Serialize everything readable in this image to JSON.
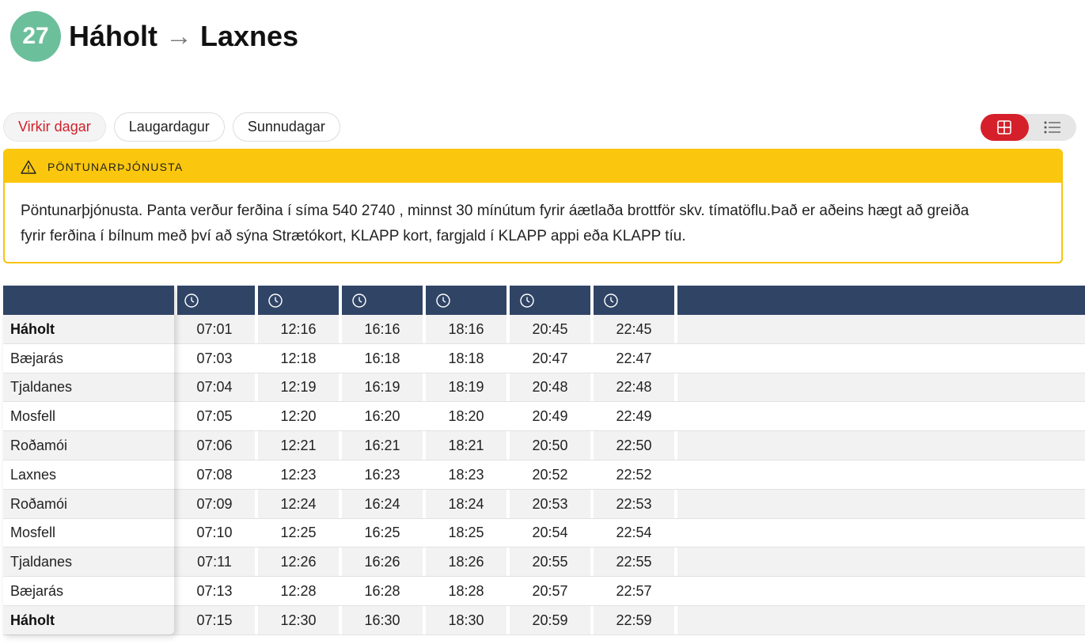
{
  "route": {
    "number": "27",
    "from": "Háholt",
    "arrow": "→",
    "to": "Laxnes",
    "badge_color": "#6cbf9b"
  },
  "day_tabs": [
    {
      "label": "Virkir dagar",
      "active": true
    },
    {
      "label": "Laugardagur",
      "active": false
    },
    {
      "label": "Sunnudagar",
      "active": false
    }
  ],
  "view_toggle": {
    "active": "grid",
    "options": [
      "grid-icon",
      "list-icon"
    ],
    "accent": "#d5202b"
  },
  "notice": {
    "title": "PÖNTUNARÞJÓNUSTA",
    "icon": "warning-icon",
    "body_line1": "Pöntunarþjónusta. Panta verður ferðina í síma 540 2740 , minnst 30 mínútum fyrir áætlaða brottför skv. tímatöflu.Það er aðeins hægt að greiða",
    "body_line2": "fyrir ferðina í bílnum með því að sýna Strætókort, KLAPP kort, fargjald í KLAPP appi eða KLAPP tíu.",
    "accent": "#fbc70e"
  },
  "timetable": {
    "header_color": "#304466",
    "column_icon": "clock-icon",
    "stops": [
      {
        "name": "Háholt",
        "bold": true,
        "times": [
          "07:01",
          "12:16",
          "16:16",
          "18:16",
          "20:45",
          "22:45"
        ]
      },
      {
        "name": "Bæjarás",
        "bold": false,
        "times": [
          "07:03",
          "12:18",
          "16:18",
          "18:18",
          "20:47",
          "22:47"
        ]
      },
      {
        "name": "Tjaldanes",
        "bold": false,
        "times": [
          "07:04",
          "12:19",
          "16:19",
          "18:19",
          "20:48",
          "22:48"
        ]
      },
      {
        "name": "Mosfell",
        "bold": false,
        "times": [
          "07:05",
          "12:20",
          "16:20",
          "18:20",
          "20:49",
          "22:49"
        ]
      },
      {
        "name": "Roðamói",
        "bold": false,
        "times": [
          "07:06",
          "12:21",
          "16:21",
          "18:21",
          "20:50",
          "22:50"
        ]
      },
      {
        "name": "Laxnes",
        "bold": false,
        "times": [
          "07:08",
          "12:23",
          "16:23",
          "18:23",
          "20:52",
          "22:52"
        ]
      },
      {
        "name": "Roðamói",
        "bold": false,
        "times": [
          "07:09",
          "12:24",
          "16:24",
          "18:24",
          "20:53",
          "22:53"
        ]
      },
      {
        "name": "Mosfell",
        "bold": false,
        "times": [
          "07:10",
          "12:25",
          "16:25",
          "18:25",
          "20:54",
          "22:54"
        ]
      },
      {
        "name": "Tjaldanes",
        "bold": false,
        "times": [
          "07:11",
          "12:26",
          "16:26",
          "18:26",
          "20:55",
          "22:55"
        ]
      },
      {
        "name": "Bæjarás",
        "bold": false,
        "times": [
          "07:13",
          "12:28",
          "16:28",
          "18:28",
          "20:57",
          "22:57"
        ]
      },
      {
        "name": "Háholt",
        "bold": true,
        "times": [
          "07:15",
          "12:30",
          "16:30",
          "18:30",
          "20:59",
          "22:59"
        ]
      }
    ]
  }
}
